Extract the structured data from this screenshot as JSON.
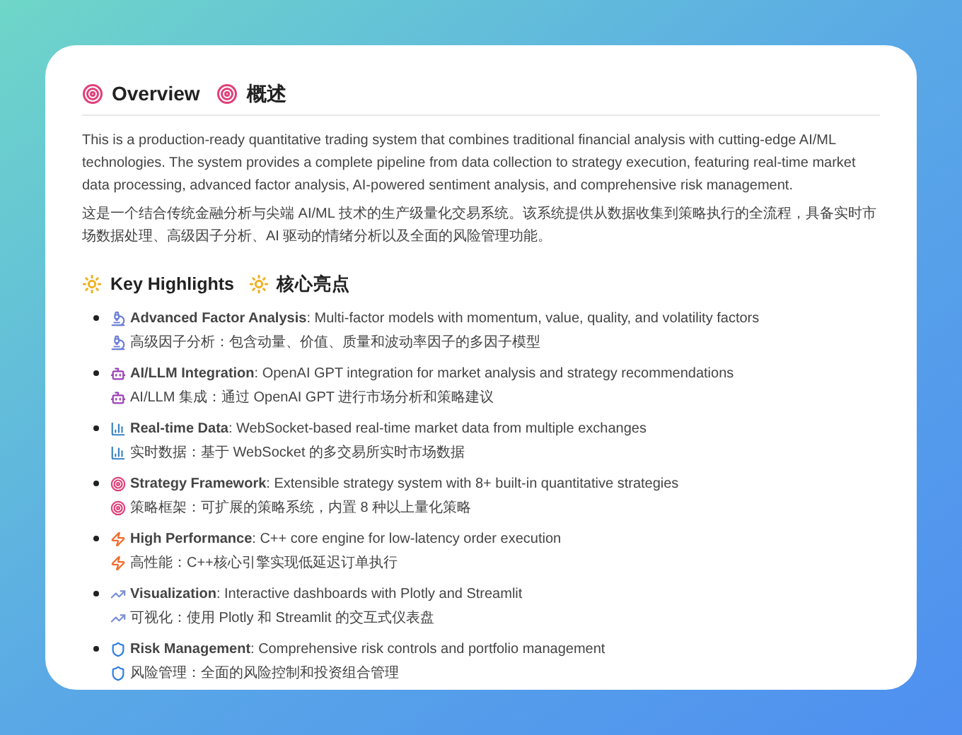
{
  "overview": {
    "title": "Overview",
    "title_zh": "概述",
    "paragraphs": [
      "This is a production-ready quantitative trading system that combines traditional financial analysis with cutting-edge AI/ML technologies. The system provides a complete pipeline from data collection to strategy execution, featuring real-time market data processing, advanced factor analysis, AI-powered sentiment analysis, and comprehensive risk management.",
      "这是一个结合传统金融分析与尖端 AI/ML 技术的生产级量化交易系统。该系统提供从数据收集到策略执行的全流程，具备实时市场数据处理、高级因子分析、AI 驱动的情绪分析以及全面的风险管理功能。"
    ]
  },
  "highlights": {
    "title": "Key Highlights",
    "title_zh": "核心亮点",
    "items": [
      {
        "text": "**Advanced Factor Analysis**: Multi-factor models with momentum, value, quality, and volatility factors",
        "text_zh": "高级因子分析：包含动量、价值、质量和波动率因子的多因子模型"
      },
      {
        "text": "**AI/LLM Integration**: OpenAI GPT integration for market analysis and strategy recommendations",
        "text_zh": "AI/LLM 集成：通过 OpenAI GPT 进行市场分析和策略建议"
      },
      {
        "text": "**Real-time Data**: WebSocket-based real-time market data from multiple exchanges",
        "text_zh": "实时数据：基于 WebSocket 的多交易所实时市场数据"
      },
      {
        "text": "**Strategy Framework**: Extensible strategy system with 8+ built-in quantitative strategies",
        "text_zh": "策略框架：可扩展的策略系统，内置 8 种以上量化策略"
      },
      {
        "text": "**High Performance**: C++ core engine for low-latency order execution",
        "text_zh": "高性能：C++核心引擎实现低延迟订单执行"
      },
      {
        "text": "**Visualization**: Interactive dashboards with Plotly and Streamlit",
        "text_zh": "可视化：使用 Plotly 和 Streamlit 的交互式仪表盘"
      },
      {
        "text": "**Risk Management**: Comprehensive risk controls and portfolio management",
        "text_zh": "风险管理：全面的风险控制和投资组合管理"
      }
    ]
  }
}
